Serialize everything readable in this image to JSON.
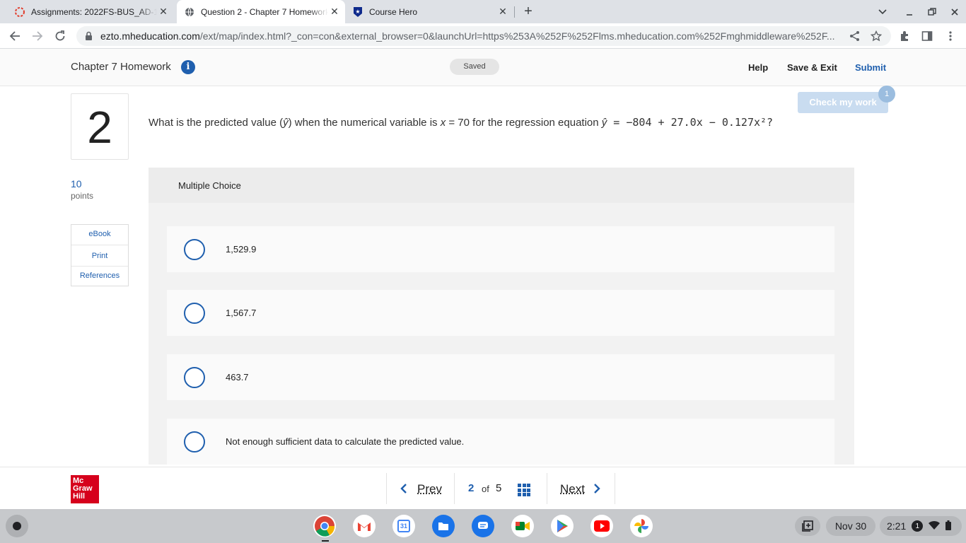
{
  "browser": {
    "tabs": [
      {
        "title": "Assignments: 2022FS-BUS_AD-1",
        "icon": "canvas-icon",
        "active": false
      },
      {
        "title": "Question 2 - Chapter 7 Homework",
        "icon": "globe-icon",
        "active": true
      },
      {
        "title": "Course Hero",
        "icon": "course-hero-icon",
        "active": false
      }
    ],
    "new_tab": "+",
    "url_host": "ezto.mheducation.com",
    "url_path": "/ext/map/index.html?_con=con&external_browser=0&launchUrl=https%253A%252F%252Flms.mheducation.com%252Fmghmiddleware%252F..."
  },
  "header": {
    "title": "Chapter 7 Homework",
    "saved": "Saved",
    "help": "Help",
    "save_exit": "Save & Exit",
    "submit": "Submit"
  },
  "question": {
    "number": "2",
    "check_label": "Check my work",
    "check_badge": "1",
    "points_value": "10",
    "points_label": "points",
    "text_1": "What is the predicted value (",
    "yhat": "ŷ",
    "text_2": ")  when the numerical variable is ",
    "x": "x",
    "text_3": " = 70 for the regression equation ",
    "yhat2": "ŷ",
    "equation": " = −804 + 27.0x − 0.127x²?"
  },
  "sidemenu": {
    "ebook": "eBook",
    "print": "Print",
    "references": "References"
  },
  "choices": {
    "header": "Multiple Choice",
    "options": [
      {
        "label": "1,529.9"
      },
      {
        "label": "1,567.7"
      },
      {
        "label": "463.7"
      },
      {
        "label": "Not enough sufficient data to calculate the predicted value."
      }
    ]
  },
  "footer": {
    "logo_line1": "Mc",
    "logo_line2": "Graw",
    "logo_line3": "Hill",
    "prev": "Prev",
    "next": "Next",
    "current": "2",
    "of": "of",
    "total": "5"
  },
  "shelf": {
    "date": "Nov 30",
    "time": "2:21",
    "notif": "1",
    "calendar_day": "31"
  },
  "colors": {
    "accent": "#1f5fae",
    "brand_red": "#d6001c"
  }
}
